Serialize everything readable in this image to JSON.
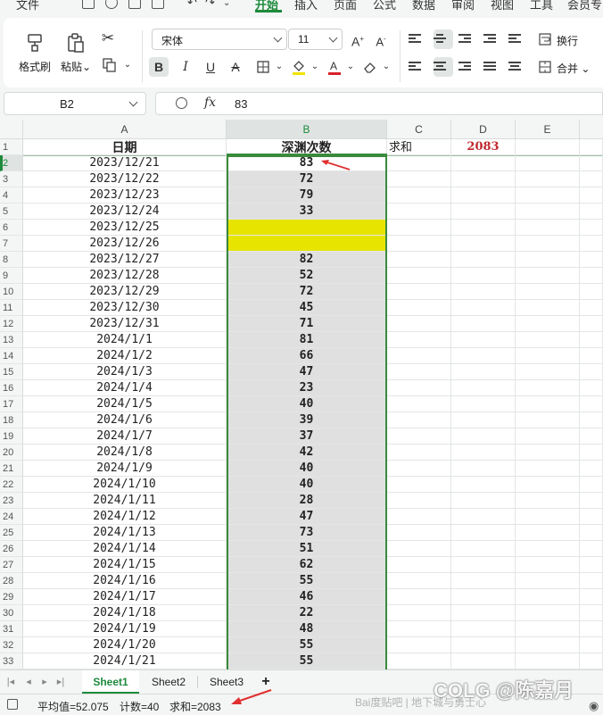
{
  "menu": {
    "items": [
      "文件",
      "开始",
      "插入",
      "页面",
      "公式",
      "数据",
      "审阅",
      "视图",
      "工具",
      "会员专"
    ],
    "active": "开始"
  },
  "ribbon": {
    "format_painter": "格式刷",
    "paste": "粘贴",
    "font_name": "宋体",
    "font_size": "11",
    "wrap": "换行",
    "merge": "合并"
  },
  "formula_bar": {
    "name_box": "B2",
    "fx": "fx",
    "value": "83"
  },
  "columns": [
    "A",
    "B",
    "C",
    "D",
    "E"
  ],
  "header_row": {
    "row_num": "1",
    "a": "日期",
    "b": "深渊次数",
    "c": "求和",
    "d": "2083"
  },
  "rows": [
    {
      "n": "2",
      "date": "2023/12/21",
      "val": "83"
    },
    {
      "n": "3",
      "date": "2023/12/22",
      "val": "72"
    },
    {
      "n": "4",
      "date": "2023/12/23",
      "val": "79"
    },
    {
      "n": "5",
      "date": "2023/12/24",
      "val": "33"
    },
    {
      "n": "6",
      "date": "2023/12/25",
      "val": ""
    },
    {
      "n": "7",
      "date": "2023/12/26",
      "val": ""
    },
    {
      "n": "8",
      "date": "2023/12/27",
      "val": "82"
    },
    {
      "n": "9",
      "date": "2023/12/28",
      "val": "52"
    },
    {
      "n": "10",
      "date": "2023/12/29",
      "val": "72"
    },
    {
      "n": "11",
      "date": "2023/12/30",
      "val": "45"
    },
    {
      "n": "12",
      "date": "2023/12/31",
      "val": "71"
    },
    {
      "n": "13",
      "date": "2024/1/1",
      "val": "81"
    },
    {
      "n": "14",
      "date": "2024/1/2",
      "val": "66"
    },
    {
      "n": "15",
      "date": "2024/1/3",
      "val": "47"
    },
    {
      "n": "16",
      "date": "2024/1/4",
      "val": "23"
    },
    {
      "n": "17",
      "date": "2024/1/5",
      "val": "40"
    },
    {
      "n": "18",
      "date": "2024/1/6",
      "val": "39"
    },
    {
      "n": "19",
      "date": "2024/1/7",
      "val": "37"
    },
    {
      "n": "20",
      "date": "2024/1/8",
      "val": "42"
    },
    {
      "n": "21",
      "date": "2024/1/9",
      "val": "40"
    },
    {
      "n": "22",
      "date": "2024/1/10",
      "val": "40"
    },
    {
      "n": "23",
      "date": "2024/1/11",
      "val": "28"
    },
    {
      "n": "24",
      "date": "2024/1/12",
      "val": "47"
    },
    {
      "n": "25",
      "date": "2024/1/13",
      "val": "73"
    },
    {
      "n": "26",
      "date": "2024/1/14",
      "val": "51"
    },
    {
      "n": "27",
      "date": "2024/1/15",
      "val": "62"
    },
    {
      "n": "28",
      "date": "2024/1/16",
      "val": "55"
    },
    {
      "n": "29",
      "date": "2024/1/17",
      "val": "46"
    },
    {
      "n": "30",
      "date": "2024/1/18",
      "val": "22"
    },
    {
      "n": "31",
      "date": "2024/1/19",
      "val": "48"
    },
    {
      "n": "32",
      "date": "2024/1/20",
      "val": "55"
    },
    {
      "n": "33",
      "date": "2024/1/21",
      "val": "55"
    }
  ],
  "highlight_color": "#e7e400",
  "accent_color": "#1e8a3c",
  "sheets": [
    "Sheet1",
    "Sheet2",
    "Sheet3"
  ],
  "active_sheet": "Sheet1",
  "status": {
    "average": "平均值=52.075",
    "count": "计数=40",
    "sum": "求和=2083"
  },
  "watermark": {
    "main": "COLG @陈嘉月",
    "sub": "Bai度贴吧 | 地下城与勇士心"
  }
}
